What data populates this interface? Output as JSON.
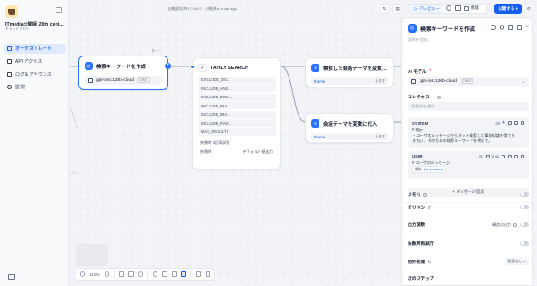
{
  "app": {
    "title": "ITmedia公開版 20th cent...",
    "subtitle": "チャットフロー"
  },
  "sidebar": {
    "items": [
      {
        "label": "オーケストレート",
        "icon": "orchestrate-icon",
        "active": true
      },
      {
        "label": "API アクセス",
        "icon": "api-icon",
        "active": false
      },
      {
        "label": "ログ＆アナウンス",
        "icon": "log-icon",
        "active": false
      },
      {
        "label": "監視",
        "icon": "monitor-icon",
        "active": false
      }
    ]
  },
  "topbar": {
    "status": "自動保存済 17:44:57 · 公開済み a day ago",
    "preview_label": "▷ プレビュー",
    "features_label": "機能",
    "publish_label": "公開する ▾"
  },
  "nodes": {
    "llm": {
      "title": "検索キーワードを作成",
      "model": "gpt-oss:120b-cloud",
      "model_badge": "CHAT"
    },
    "tavily": {
      "title": "TAVILY SEARCH",
      "params": [
        "EXCLUDE_DO...",
        "INCLUDE_ANS...",
        "INCLUDE_DOM...",
        "INCLUDE_IMA...",
        "INCLUDE_IMA...",
        "INCLUDE_RAW...",
        "MAX_RESULTS"
      ],
      "kv": [
        {
          "key": "失敗時 3回再試行",
          "value": ""
        },
        {
          "key": "失敗時",
          "value": "デフォルト値出力"
        }
      ]
    },
    "assign1": {
      "title": "検索した会話テーマを変数に代入",
      "var": "theme",
      "var_type": "上書き"
    },
    "assign2": {
      "title": "会話テーマを変数に代入",
      "var": "theme",
      "var_type": "上書き"
    }
  },
  "bottombar": {
    "zoom": "110%"
  },
  "panel": {
    "title": "検索キーワードを作成",
    "desc_placeholder": "説明を追加...",
    "model_label": "AI モデル",
    "model_name": "gpt-oss:120b-cloud",
    "model_badge": "CHAT",
    "context_label": "コンテキスト",
    "context_placeholder": "変数値を選択",
    "system": {
      "label": "SYSTEM",
      "count": "99",
      "body_line1": "# 指示",
      "body_line2": "・ユーザのメッセージからネット検索して事前知識を得てお",
      "body_line3": "きたい、そのための検索キーワードを考えて。"
    },
    "user": {
      "label": "USER",
      "count": "28",
      "type_label": "jinja",
      "body_line1": "# ユーザのメッセージ",
      "var_source": "開始",
      "var_name": "{x} sys.query"
    },
    "add_message": "+ メッセージ追加",
    "memory_label": "メモリ",
    "vision_label": "ビジョン",
    "output_var_label": "出力変数",
    "structured_label": "構造化出力",
    "retry_label": "失敗時再試行",
    "exception_label": "例外処理",
    "exception_value": "処理なし ⌄",
    "next_step_label": "次のステップ"
  }
}
